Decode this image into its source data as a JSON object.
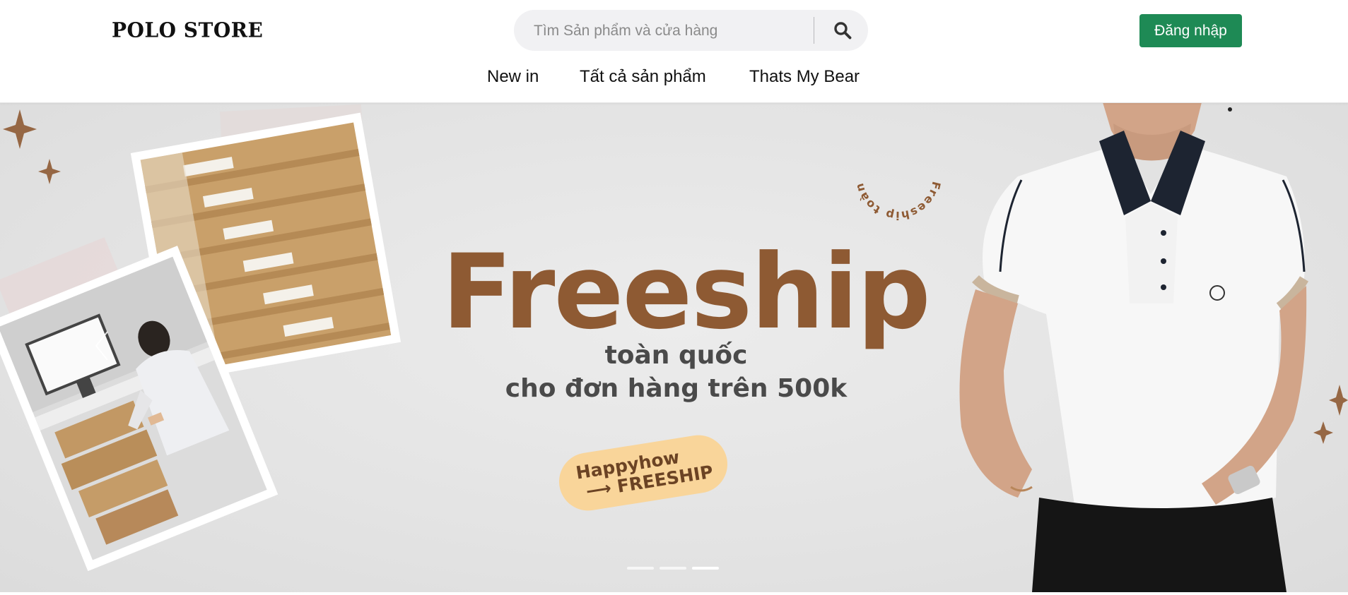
{
  "header": {
    "logo": "POLO STORE",
    "search": {
      "placeholder": "Tìm Sản phẩm và cửa hàng"
    },
    "login_label": "Đăng nhập",
    "nav": [
      {
        "label": "New in"
      },
      {
        "label": "Tất cả sản phẩm"
      },
      {
        "label": "Thats My Bear"
      }
    ]
  },
  "banner": {
    "circle_text": "Freeship toàn quốc - Happyhow -",
    "headline": "Freeship",
    "line1": "toàn quốc",
    "line2": "cho đơn hàng trên 500k",
    "pill_line1": "Happyhow",
    "pill_line2": "⟶ FREESHIP",
    "active_slide": 3,
    "slide_count": 3
  },
  "icons": {
    "search": "search-icon",
    "prev": "chevron-left-icon"
  },
  "colors": {
    "brand_green": "#1e8a55",
    "headline_brown": "#8e5a33",
    "pill_yellow": "#f9d59a"
  }
}
